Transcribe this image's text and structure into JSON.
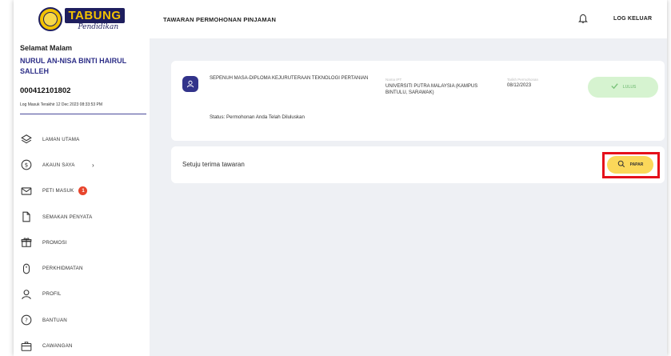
{
  "brand": {
    "logo_main": "TABUNG",
    "logo_sub": "Pendidikan"
  },
  "sidebar": {
    "greeting": "Selamat Malam",
    "user_name": "NURUL AN-NISA BINTI HAIRUL SALLEH",
    "user_id": "000412101802",
    "last_login": "Log Masuk Terakhir 12 Dec 2023 08:33:53 PM",
    "items": [
      {
        "label": "LAMAN UTAMA",
        "icon": "layers-icon"
      },
      {
        "label": "AKAUN SAYA",
        "icon": "dollar-circle-icon",
        "has_chevron": true
      },
      {
        "label": "PETI MASUK",
        "icon": "mail-icon",
        "badge": "1"
      },
      {
        "label": "SEMAKAN PENYATA",
        "icon": "document-icon"
      },
      {
        "label": "PROMOSI",
        "icon": "gift-icon"
      },
      {
        "label": "PERKHIDMATAN",
        "icon": "mouse-icon"
      },
      {
        "label": "PROFIL",
        "icon": "user-icon"
      },
      {
        "label": "BANTUAN",
        "icon": "help-circle-icon"
      },
      {
        "label": "CAWANGAN",
        "icon": "building-icon"
      }
    ]
  },
  "header": {
    "title": "TAWARAN PERMOHONAN PINJAMAN",
    "logout_label": "LOG KELUAR"
  },
  "application": {
    "course": "SEPENUH MASA-DIPLOMA KEJURUTERAAN TEKNOLOGI PERTANIAN",
    "institution_label": "Nama IPT",
    "institution": "UNIVERSITI PUTRA MALAYSIA (KAMPUS BINTULU, SARAWAK)",
    "date_label": "Tarikh Permohonan",
    "date": "08/12/2023",
    "status_badge": "LULUS",
    "status_text": "Status: Permohonan Anda Telah Diluluskan"
  },
  "offer": {
    "text": "Setuju terima tawaran",
    "view_label": "PAPAR"
  },
  "colors": {
    "brand_navy": "#2e2f88",
    "accent_yellow": "#fbd85a",
    "success_green": "#d6f3d0",
    "highlight_red": "#e5101b",
    "badge_red": "#e8452c"
  }
}
